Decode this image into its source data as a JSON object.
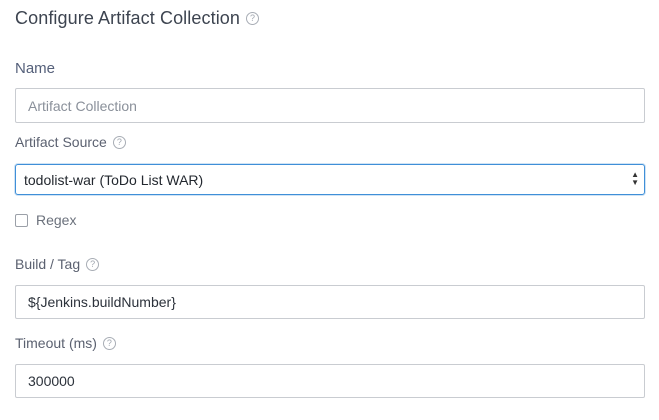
{
  "dialog": {
    "title": "Configure Artifact Collection",
    "help_glyph": "?"
  },
  "name": {
    "label": "Name",
    "value": "Artifact Collection"
  },
  "artifact_source": {
    "label": "Artifact Source",
    "selected": "todolist-war (ToDo List WAR)"
  },
  "regex": {
    "label": "Regex",
    "checked": false
  },
  "build_tag": {
    "label": "Build / Tag",
    "value": "${Jenkins.buildNumber}"
  },
  "timeout": {
    "label": "Timeout (ms)",
    "value": "300000"
  },
  "icons": {
    "help": "help-circle-icon",
    "select_caret": "up-down-caret-icon"
  },
  "colors": {
    "focus_border": "#3f8fd8",
    "input_border": "#c9ccd1"
  }
}
